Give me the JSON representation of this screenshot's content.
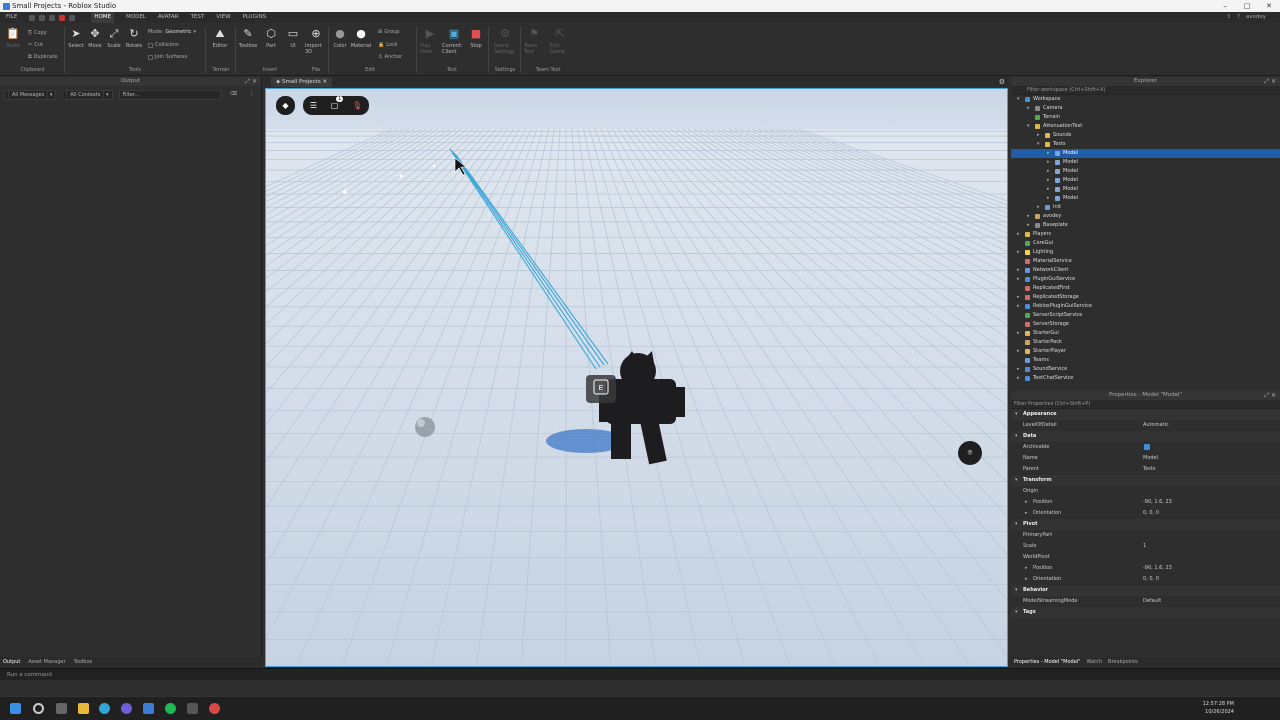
{
  "window": {
    "title": "Small Projects - Roblox Studio",
    "controls": [
      "–",
      "□",
      "✕"
    ]
  },
  "menu": {
    "items": [
      "FILE",
      "HOME",
      "MODEL",
      "AVATAR",
      "TEST",
      "VIEW",
      "PLUGINS"
    ],
    "active": "HOME",
    "user": "avodey"
  },
  "ribbon": {
    "clipboard": {
      "paste": "Paste",
      "copy": "Copy",
      "cut": "Cut",
      "duplicate": "Duplicate",
      "group": "Clipboard"
    },
    "tools": {
      "select": "Select",
      "move": "Move",
      "scale": "Scale",
      "rotate": "Rotate",
      "mode_label": "Mode:",
      "mode_value": "Geometric",
      "collisions": "Collisions",
      "join": "Join Surfaces",
      "group": "Tools"
    },
    "terrain": {
      "editor": "Editor",
      "group": "Terrain"
    },
    "insert": {
      "toolbox": "Toolbox",
      "part": "Part",
      "ui": "UI",
      "group": "Insert"
    },
    "file": {
      "import": "Import 3D",
      "group": "File"
    },
    "edit": {
      "color": "Color",
      "material": "Material",
      "group_btn": "Group",
      "lock": "Lock",
      "anchor": "Anchor",
      "group": "Edit"
    },
    "test": {
      "play": "Play Here",
      "current": "Current: Client",
      "stop": "Stop",
      "group": "Test"
    },
    "settings": {
      "game_settings": "Game Settings",
      "group": "Settings"
    },
    "team_test": {
      "team_test": "Team Test",
      "exit_game": "Exit Game",
      "group": "Team Test"
    }
  },
  "output": {
    "title": "Output",
    "messages_filter": "All Messages",
    "contexts_filter": "All Contexts",
    "filter_placeholder": "Filter..."
  },
  "bottom_left_tabs": [
    "Output",
    "Asset Manager",
    "Toolbox"
  ],
  "command_bar": {
    "placeholder": "Run a command"
  },
  "viewport": {
    "tab": "Small Projects",
    "badge": "1",
    "prompt_key": "E"
  },
  "explorer": {
    "title": "Explorer",
    "filter_placeholder": "Filter workspace (Ctrl+Shift+X)",
    "tree": [
      {
        "label": "Workspace",
        "depth": 0,
        "twisty": "▾",
        "color": "#4a90d9"
      },
      {
        "label": "Camera",
        "depth": 1,
        "twisty": "▸",
        "color": "#8a8a8a"
      },
      {
        "label": "Terrain",
        "depth": 1,
        "twisty": "",
        "color": "#4caf50"
      },
      {
        "label": "AttenuationTest",
        "depth": 1,
        "twisty": "▾",
        "color": "#e0b84a"
      },
      {
        "label": "Sounds",
        "depth": 2,
        "twisty": "▸",
        "color": "#e0b84a"
      },
      {
        "label": "Tests",
        "depth": 2,
        "twisty": "▾",
        "color": "#e0b84a"
      },
      {
        "label": "Model",
        "depth": 3,
        "twisty": "▸",
        "color": "#7fa6d8",
        "selected": true
      },
      {
        "label": "Model",
        "depth": 3,
        "twisty": "▸",
        "color": "#7fa6d8"
      },
      {
        "label": "Model",
        "depth": 3,
        "twisty": "▸",
        "color": "#7fa6d8"
      },
      {
        "label": "Model",
        "depth": 3,
        "twisty": "▸",
        "color": "#7fa6d8"
      },
      {
        "label": "Model",
        "depth": 3,
        "twisty": "▸",
        "color": "#7fa6d8"
      },
      {
        "label": "Model",
        "depth": 3,
        "twisty": "▸",
        "color": "#7fa6d8"
      },
      {
        "label": "Init",
        "depth": 2,
        "twisty": "▸",
        "color": "#6a9bd8"
      },
      {
        "label": "avodey",
        "depth": 1,
        "twisty": "▸",
        "color": "#c9a46a"
      },
      {
        "label": "Baseplate",
        "depth": 1,
        "twisty": "▸",
        "color": "#8a8a8a"
      },
      {
        "label": "Players",
        "depth": 0,
        "twisty": "▸",
        "color": "#e0b84a"
      },
      {
        "label": "CoreGui",
        "depth": 0,
        "twisty": "",
        "color": "#4caf50"
      },
      {
        "label": "Lighting",
        "depth": 0,
        "twisty": "▸",
        "color": "#f5d547"
      },
      {
        "label": "MaterialService",
        "depth": 0,
        "twisty": "",
        "color": "#d46a6a"
      },
      {
        "label": "NetworkClient",
        "depth": 0,
        "twisty": "▸",
        "color": "#6a9bd8"
      },
      {
        "label": "PluginGuiService",
        "depth": 0,
        "twisty": "▸",
        "color": "#4a90d9"
      },
      {
        "label": "ReplicatedFirst",
        "depth": 0,
        "twisty": "",
        "color": "#d46a6a"
      },
      {
        "label": "ReplicatedStorage",
        "depth": 0,
        "twisty": "▸",
        "color": "#d46a6a"
      },
      {
        "label": "RobloxPluginGuiService",
        "depth": 0,
        "twisty": "▸",
        "color": "#4a90d9"
      },
      {
        "label": "ServerScriptService",
        "depth": 0,
        "twisty": "",
        "color": "#4caf50"
      },
      {
        "label": "ServerStorage",
        "depth": 0,
        "twisty": "",
        "color": "#d46a6a"
      },
      {
        "label": "StarterGui",
        "depth": 0,
        "twisty": "▸",
        "color": "#e0b84a"
      },
      {
        "label": "StarterPack",
        "depth": 0,
        "twisty": "",
        "color": "#c9a46a"
      },
      {
        "label": "StarterPlayer",
        "depth": 0,
        "twisty": "▸",
        "color": "#e0b84a"
      },
      {
        "label": "Teams",
        "depth": 0,
        "twisty": "",
        "color": "#6a9bd8"
      },
      {
        "label": "SoundService",
        "depth": 0,
        "twisty": "▸",
        "color": "#4a90d9"
      },
      {
        "label": "TextChatService",
        "depth": 0,
        "twisty": "▸",
        "color": "#4a90d9"
      }
    ]
  },
  "properties": {
    "title": "Properties - Model \"Model\"",
    "filter_placeholder": "Filter Properties (Ctrl+Shift+P)",
    "rows": [
      {
        "kind": "cat",
        "label": "Appearance"
      },
      {
        "kind": "prop",
        "label": "LevelOfDetail",
        "value": "Automatic",
        "indent": 12
      },
      {
        "kind": "cat",
        "label": "Data"
      },
      {
        "kind": "check",
        "label": "Archivable",
        "value": "",
        "indent": 12
      },
      {
        "kind": "prop",
        "label": "Name",
        "value": "Model",
        "indent": 12
      },
      {
        "kind": "prop",
        "label": "Parent",
        "value": "Tests",
        "indent": 12
      },
      {
        "kind": "cat",
        "label": "Transform"
      },
      {
        "kind": "prop",
        "label": "Origin",
        "value": "",
        "indent": 12
      },
      {
        "kind": "prop",
        "label": "Position",
        "value": "-90, 1.6, 23",
        "indent": 22,
        "twisty": true
      },
      {
        "kind": "prop",
        "label": "Orientation",
        "value": "0, 0, 0",
        "indent": 22,
        "twisty": true
      },
      {
        "kind": "cat",
        "label": "Pivot"
      },
      {
        "kind": "prop",
        "label": "PrimaryPart",
        "value": "",
        "indent": 12
      },
      {
        "kind": "prop",
        "label": "Scale",
        "value": "1",
        "indent": 12
      },
      {
        "kind": "prop",
        "label": "WorldPivot",
        "value": "",
        "indent": 12
      },
      {
        "kind": "prop",
        "label": "Position",
        "value": "-90, 1.6, 23",
        "indent": 22,
        "twisty": true
      },
      {
        "kind": "prop",
        "label": "Orientation",
        "value": "0, 0, 0",
        "indent": 22,
        "twisty": true
      },
      {
        "kind": "cat",
        "label": "Behavior"
      },
      {
        "kind": "prop",
        "label": "ModelStreamingMode",
        "value": "Default",
        "indent": 12
      },
      {
        "kind": "cat",
        "label": "Tags"
      }
    ]
  },
  "bottom_right_tabs": [
    "Properties - Model \"Model\"",
    "Watch",
    "Breakpoints"
  ],
  "taskbar": {
    "time": "12:57:28 PM",
    "date": "10/26/2024"
  },
  "colors": {
    "selection": "#1f5da8",
    "viewport_border": "#4a9fd9",
    "beam": "#39a7d8"
  }
}
